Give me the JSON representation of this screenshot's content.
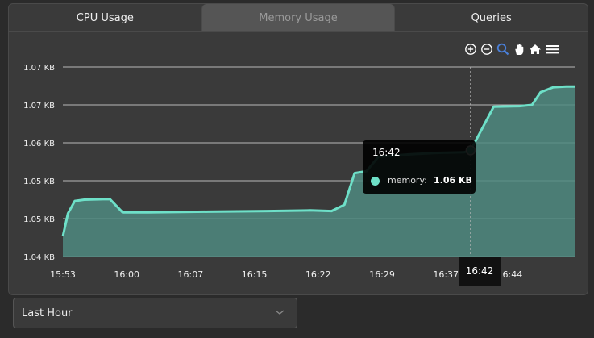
{
  "tabs": [
    {
      "label": "CPU Usage",
      "active": false
    },
    {
      "label": "Memory Usage",
      "active": true
    },
    {
      "label": "Queries",
      "active": false
    }
  ],
  "toolbar": {
    "icons": [
      "zoom-in-icon",
      "zoom-out-icon",
      "selection-zoom-icon",
      "pan-icon",
      "home-icon",
      "menu-icon"
    ]
  },
  "colors": {
    "series": "#6ee0c8",
    "fill": "#4f8a80",
    "grid": "#cfcfcf",
    "zoom_icon_active": "#4a7fd8"
  },
  "chart_data": {
    "type": "area",
    "title": "",
    "xlabel": "",
    "ylabel": "",
    "x_ticks": [
      "15:53",
      "16:00",
      "16:07",
      "16:15",
      "16:22",
      "16:29",
      "16:37",
      "16:44"
    ],
    "y_ticks": [
      "1.04 KB",
      "1.05 KB",
      "1.05 KB",
      "1.06 KB",
      "1.07 KB",
      "1.07 KB"
    ],
    "ylim": [
      1.04,
      1.07
    ],
    "grid": true,
    "series": [
      {
        "name": "memory",
        "points": [
          [
            0,
            1.0432
          ],
          [
            0.6,
            1.0468
          ],
          [
            1.4,
            1.0488
          ],
          [
            2.5,
            1.049
          ],
          [
            5.5,
            1.0491
          ],
          [
            7.0,
            1.047
          ],
          [
            10,
            1.047
          ],
          [
            17,
            1.0471
          ],
          [
            24,
            1.0472
          ],
          [
            29,
            1.0473
          ],
          [
            31.5,
            1.0472
          ],
          [
            33,
            1.0482
          ],
          [
            34.2,
            1.0532
          ],
          [
            35.6,
            1.0535
          ],
          [
            37,
            1.0558
          ],
          [
            41,
            1.0562
          ],
          [
            44,
            1.0564
          ],
          [
            47,
            1.0565
          ],
          [
            47.8,
            1.0568
          ],
          [
            50.5,
            1.0637
          ],
          [
            53.5,
            1.0638
          ],
          [
            55,
            1.064
          ],
          [
            56,
            1.066
          ],
          [
            57.5,
            1.0668
          ],
          [
            59,
            1.0669
          ],
          [
            60,
            1.0669
          ]
        ]
      }
    ],
    "hover": {
      "x_label": "16:42",
      "series": "memory",
      "value": "1.06 KB",
      "x": 47.8
    }
  },
  "tooltip": {
    "title": "16:42",
    "series_label": "memory:",
    "value": "1.06 KB"
  },
  "crosshair_label": "16:42",
  "range_select": {
    "value": "Last Hour"
  }
}
